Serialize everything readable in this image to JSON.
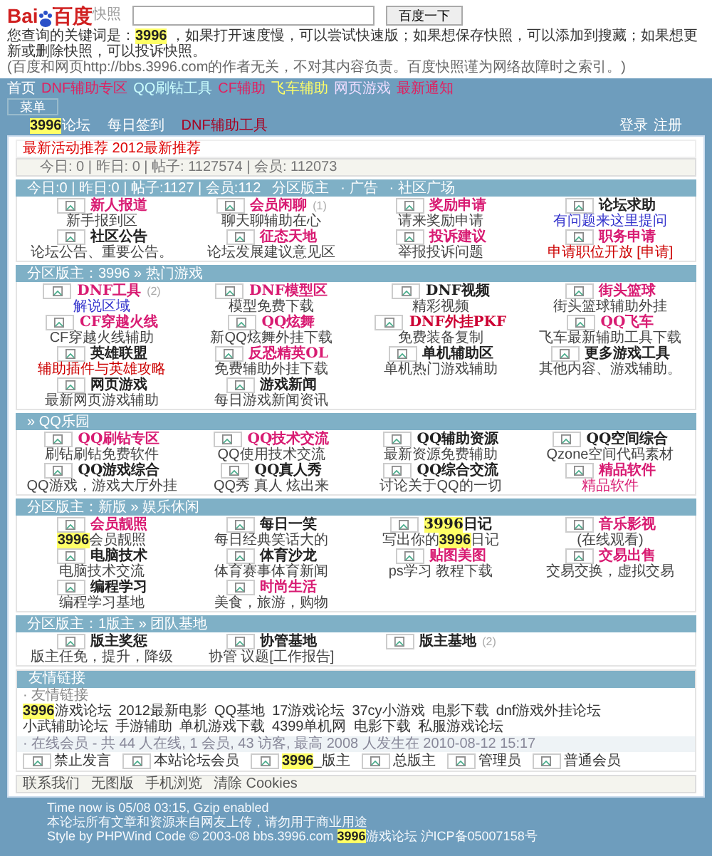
{
  "snapshot": {
    "logo_text": "Bai",
    "logo_cn": "百度",
    "logo_tag": "快照",
    "button": "百度一下",
    "keyword_line": [
      {
        "text": "您查询的关键词是："
      },
      {
        "text": "3996",
        "hl": true
      },
      {
        "text": " ，如果打开速度慢，可以尝试快速版；如果想保存快照，可以添加到搜藏；如果想更新或删除快照，可以投诉快照。"
      }
    ],
    "note": "(百度和网页http://bbs.3996.com的作者无关，不对其内容负责。百度快照谨为网络故障时之索引。)"
  },
  "top_links": [
    {
      "text": "首页",
      "color": "#ffffff"
    },
    {
      "text": "DNF辅助专区",
      "color": "#e02060"
    },
    {
      "text": "QQ刷钻工具",
      "color": "#ccffff"
    },
    {
      "text": "CF辅助",
      "color": "#e02060"
    },
    {
      "text": "飞车辅助",
      "color": "#ffff66"
    },
    {
      "text": "网页游戏",
      "color": "#eeddff"
    },
    {
      "text": "最新通知",
      "color": "#e02060"
    }
  ],
  "small_button": "菜单",
  "nav": {
    "items": [
      [
        {
          "text": "3996",
          "hl": true
        },
        {
          "text": "论坛"
        }
      ],
      [
        {
          "text": "每日签到"
        }
      ],
      [
        {
          "text": "DNF辅助工具",
          "red": true
        }
      ]
    ],
    "right": [
      "登录",
      "注册"
    ]
  },
  "notice": "最新活动推荐 2012最新推荐",
  "stats": "今日: 0 | 昨日: 0 | 帖子: 1127574 | 会员: 112073",
  "sections": [
    {
      "title": "今日:0 | 昨日:0 | 帖子:1127 | 会员:112",
      "links": [
        "分区版主",
        "· 广告",
        "· 社区广场"
      ],
      "items": [
        {
          "name": "新人报道",
          "color": "#d81b72",
          "desc": "新手报到区"
        },
        {
          "name": "会员闲聊",
          "extra": "(1)",
          "color": "#d81b72",
          "desc": "聊天聊辅助在心"
        },
        {
          "name": "奖励申请",
          "color": "#d81b72",
          "desc": "请来奖励申请"
        },
        {
          "name": "论坛求助",
          "color": "#222222",
          "desc": {
            "text": "有问题来这里提问",
            "color": "#3333cc"
          }
        },
        {
          "name": "社区公告",
          "color": "#222222",
          "desc": "论坛公告、重要公告。"
        },
        {
          "name": "征态天地",
          "color": "#d81b72",
          "desc": "论坛发展建议意见区"
        },
        {
          "name": "投诉建议",
          "color": "#d81b72",
          "desc": "举报投诉问题"
        },
        {
          "name": "职务申请",
          "color": "#d81b72",
          "desc": {
            "text": "申请职位开放 [申请]",
            "color": "#cc0000"
          }
        }
      ]
    },
    {
      "title": "分区版主：3996 » 热门游戏",
      "items": [
        {
          "name": "DNF工具",
          "extra": "(2)",
          "color": "#d81b72",
          "desc": {
            "text": "解说区域",
            "color": "#3333cc"
          }
        },
        {
          "name": "DNF模型区",
          "color": "#d81b72",
          "desc": "模型免费下载"
        },
        {
          "name": "DNF视频",
          "color": "#222222",
          "desc": "精彩视频"
        },
        {
          "name": "街头篮球",
          "color": "#d81b72",
          "desc": "街头篮球辅助外挂"
        },
        {
          "name": "CF穿越火线",
          "color": "#d81b72",
          "desc": "CF穿越火线辅助"
        },
        {
          "name": "QQ炫舞",
          "color": "#d81b72",
          "desc": "新QQ炫舞外挂下载"
        },
        {
          "name": "DNF外挂PKF",
          "color": "#cc0033",
          "desc": "免费装备复制"
        },
        {
          "name": "QQ飞车",
          "color": "#d81b72",
          "desc": "飞车最新辅助工具下载"
        },
        {
          "name": "英雄联盟",
          "color": "#222222",
          "desc": {
            "text": "辅助插件与英雄攻略",
            "color": "#cc0000"
          }
        },
        {
          "name": "反恐精英OL",
          "color": "#d81b72",
          "desc": "免费辅助外挂下载"
        },
        {
          "name": "单机辅助区",
          "color": "#222222",
          "desc": "单机热门游戏辅助"
        },
        {
          "name": "更多游戏工具",
          "color": "#222222",
          "desc": "其他内容、游戏辅助。"
        },
        {
          "name": "网页游戏",
          "color": "#222222",
          "desc": "最新网页游戏辅助"
        },
        {
          "name": "游戏新闻",
          "color": "#222222",
          "desc": "每日游戏新闻资讯"
        }
      ]
    },
    {
      "title": "» QQ乐园",
      "items": [
        {
          "name": "QQ刷钻专区",
          "color": "#d81b72",
          "desc": "刷钻刷钻免费软件"
        },
        {
          "name": "QQ技术交流",
          "color": "#d81b72",
          "desc": "QQ使用技术交流"
        },
        {
          "name": "QQ辅助资源",
          "color": "#222222",
          "desc": "最新资源免费辅助"
        },
        {
          "name": "QQ空间综合",
          "color": "#222222",
          "desc": "Qzone空间代码素材"
        },
        {
          "name": "QQ游戏综合",
          "color": "#222222",
          "desc": "QQ游戏，游戏大厅外挂"
        },
        {
          "name": "QQ真人秀",
          "color": "#222222",
          "desc": "QQ秀 真人 炫出来"
        },
        {
          "name": "QQ综合交流",
          "color": "#222222",
          "desc": "讨论关于QQ的一切"
        },
        {
          "name": "精品软件",
          "color": "#d81b72",
          "desc": {
            "text": "精品软件",
            "color": "#d81b72"
          }
        }
      ]
    },
    {
      "title": "分区版主：新版 » 娱乐休闲",
      "items": [
        {
          "name": "会员靓照",
          "color": "#d81b72",
          "desc": [
            {
              "text": "3996",
              "hl": true
            },
            {
              "text": "会员靓照"
            }
          ]
        },
        {
          "name": "每日一笑",
          "color": "#222222",
          "desc": "每日经典笑话大的"
        },
        {
          "name": [
            {
              "text": "3996",
              "hl": true
            },
            {
              "text": "日记"
            }
          ],
          "color": "#222222",
          "desc": [
            {
              "text": "写出你的"
            },
            {
              "text": "3996",
              "hl": true
            },
            {
              "text": "日记"
            }
          ]
        },
        {
          "name": "音乐影视",
          "color": "#d81b72",
          "desc": "(在线观看)"
        },
        {
          "name": "电脑技术",
          "color": "#222222",
          "desc": "电脑技术交流"
        },
        {
          "name": "体育沙龙",
          "color": "#222222",
          "desc": "体育赛事体育新闻"
        },
        {
          "name": "贴图美图",
          "color": "#d81b72",
          "desc": "ps学习 教程下载"
        },
        {
          "name": "交易出售",
          "color": "#d81b72",
          "desc": "交易交换，虚拟交易"
        },
        {
          "name": "编程学习",
          "color": "#222222",
          "desc": "编程学习基地"
        },
        {
          "name": "时尚生活",
          "color": "#d81b72",
          "desc": "美食，旅游，购物"
        }
      ]
    },
    {
      "title": "分区版主：1版主 » 团队基地",
      "items": [
        {
          "name": "版主奖惩",
          "color": "#222222",
          "desc": "版主任免，提升，降级"
        },
        {
          "name": "协管基地",
          "color": "#222222",
          "desc": "协管 议题[工作报告]"
        },
        {
          "name": "版主基地",
          "extra": "(2)",
          "color": "#222222"
        }
      ]
    }
  ],
  "friends": {
    "title": "友情链接",
    "subtitle": "· 友情链接",
    "links": [
      [
        {
          "text": "3996",
          "hl": true
        },
        {
          "text": "游戏论坛"
        }
      ],
      [
        {
          "text": "2012最新电影"
        }
      ],
      [
        {
          "text": "QQ基地"
        }
      ],
      [
        {
          "text": "17游戏论坛"
        }
      ],
      [
        {
          "text": "37cy小游戏"
        }
      ],
      [
        {
          "text": "电影下载"
        }
      ],
      [
        {
          "text": "dnf游戏外挂论坛"
        }
      ],
      [
        {
          "text": "小武辅助论坛"
        }
      ],
      [
        {
          "text": "手游辅助"
        }
      ],
      [
        {
          "text": "单机游戏下载"
        }
      ],
      [
        {
          "text": "4399单机网"
        }
      ],
      [
        {
          "text": "电影下载"
        }
      ],
      [
        {
          "text": "私服游戏论坛"
        }
      ]
    ],
    "online": "· 在线会员 - 共 44 人在线, 1 会员, 43 访客, 最高 2008 人发生在 2010-08-12 15:17",
    "legend": [
      [
        {
          "text": "禁止发言"
        }
      ],
      [
        {
          "text": "本站论坛会员"
        }
      ],
      [
        {
          "text": "3996",
          "hl": true
        },
        {
          "text": "_版主"
        }
      ],
      [
        {
          "text": "总版主"
        }
      ],
      [
        {
          "text": "管理员"
        }
      ],
      [
        {
          "text": "普通会员"
        }
      ]
    ]
  },
  "footer_links": [
    "联系我们",
    "无图版",
    "手机浏览",
    "清除 Cookies"
  ],
  "bottom": [
    [
      {
        "text": "Time now is 05/08 03:15, Gzip enabled"
      }
    ],
    [
      {
        "text": "本论坛所有文章和资源来自网友上传，请勿用于商业用途"
      }
    ],
    [
      {
        "text": "Style by PHPWind Code © 2003-08 bbs.3996.com "
      },
      {
        "text": "3996",
        "hl": true
      },
      {
        "text": "游戏论坛 沪ICP备05007158号"
      }
    ]
  ]
}
